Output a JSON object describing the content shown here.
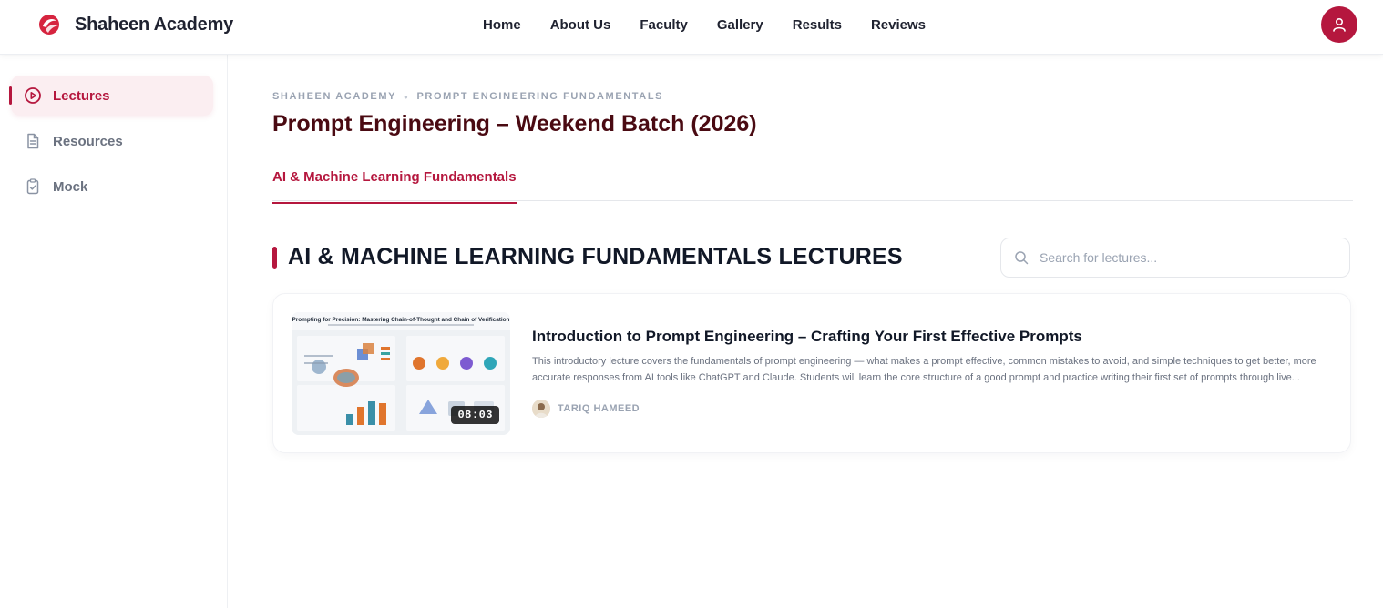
{
  "brand": {
    "name": "Shaheen Academy",
    "logo_icon": "phoenix-logo-icon",
    "accent": "#b5173e"
  },
  "nav": {
    "links": [
      {
        "label": "Home"
      },
      {
        "label": "About Us"
      },
      {
        "label": "Faculty"
      },
      {
        "label": "Gallery"
      },
      {
        "label": "Results"
      },
      {
        "label": "Reviews"
      }
    ],
    "profile_icon": "user-icon"
  },
  "sidebar": {
    "items": [
      {
        "label": "Lectures",
        "icon": "play-circle-icon",
        "active": true
      },
      {
        "label": "Resources",
        "icon": "document-icon",
        "active": false
      },
      {
        "label": "Mock",
        "icon": "clipboard-check-icon",
        "active": false
      }
    ]
  },
  "breadcrumb": {
    "root": "SHAHEEN ACADEMY",
    "current": "PROMPT ENGINEERING FUNDAMENTALS"
  },
  "page": {
    "title": "Prompt Engineering – Weekend Batch (2026)"
  },
  "tabs": [
    {
      "label": "AI & Machine Learning Fundamentals",
      "active": true
    }
  ],
  "section": {
    "title": "AI & MACHINE LEARNING FUNDAMENTALS LECTURES"
  },
  "search": {
    "placeholder": "Search for lectures...",
    "value": ""
  },
  "lectures": [
    {
      "title": "Introduction to Prompt Engineering – Crafting Your First Effective Prompts",
      "description": "This introductory lecture covers the fundamentals of prompt engineering — what makes a prompt effective, common mistakes to avoid, and simple techniques to get better, more accurate responses from AI tools like ChatGPT and Claude. Students will learn the core structure of a good prompt and practice writing their first set of prompts through live...",
      "author": "TARIQ HAMEED",
      "duration": "08:03",
      "thumbnail_title": "Prompting for Precision: Mastering Chain-of-Thought and Chain of Verification"
    }
  ]
}
